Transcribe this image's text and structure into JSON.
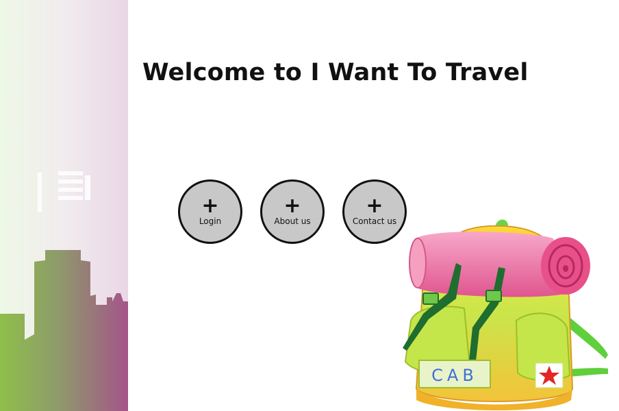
{
  "title": "Welcome to I Want To Travel",
  "buttons": [
    {
      "icon": "plus-icon",
      "symbol": "+",
      "label": "Login"
    },
    {
      "icon": "plus-icon",
      "symbol": "+",
      "label": "About us"
    },
    {
      "icon": "plus-icon",
      "symbol": "+",
      "label": "Contact us"
    }
  ],
  "backpack": {
    "tag_text": "CAB"
  },
  "colors": {
    "button_fill": "#c8c8c8",
    "button_border": "#111111",
    "skyline_green": "#8db356",
    "skyline_purple": "#a65d8e"
  }
}
